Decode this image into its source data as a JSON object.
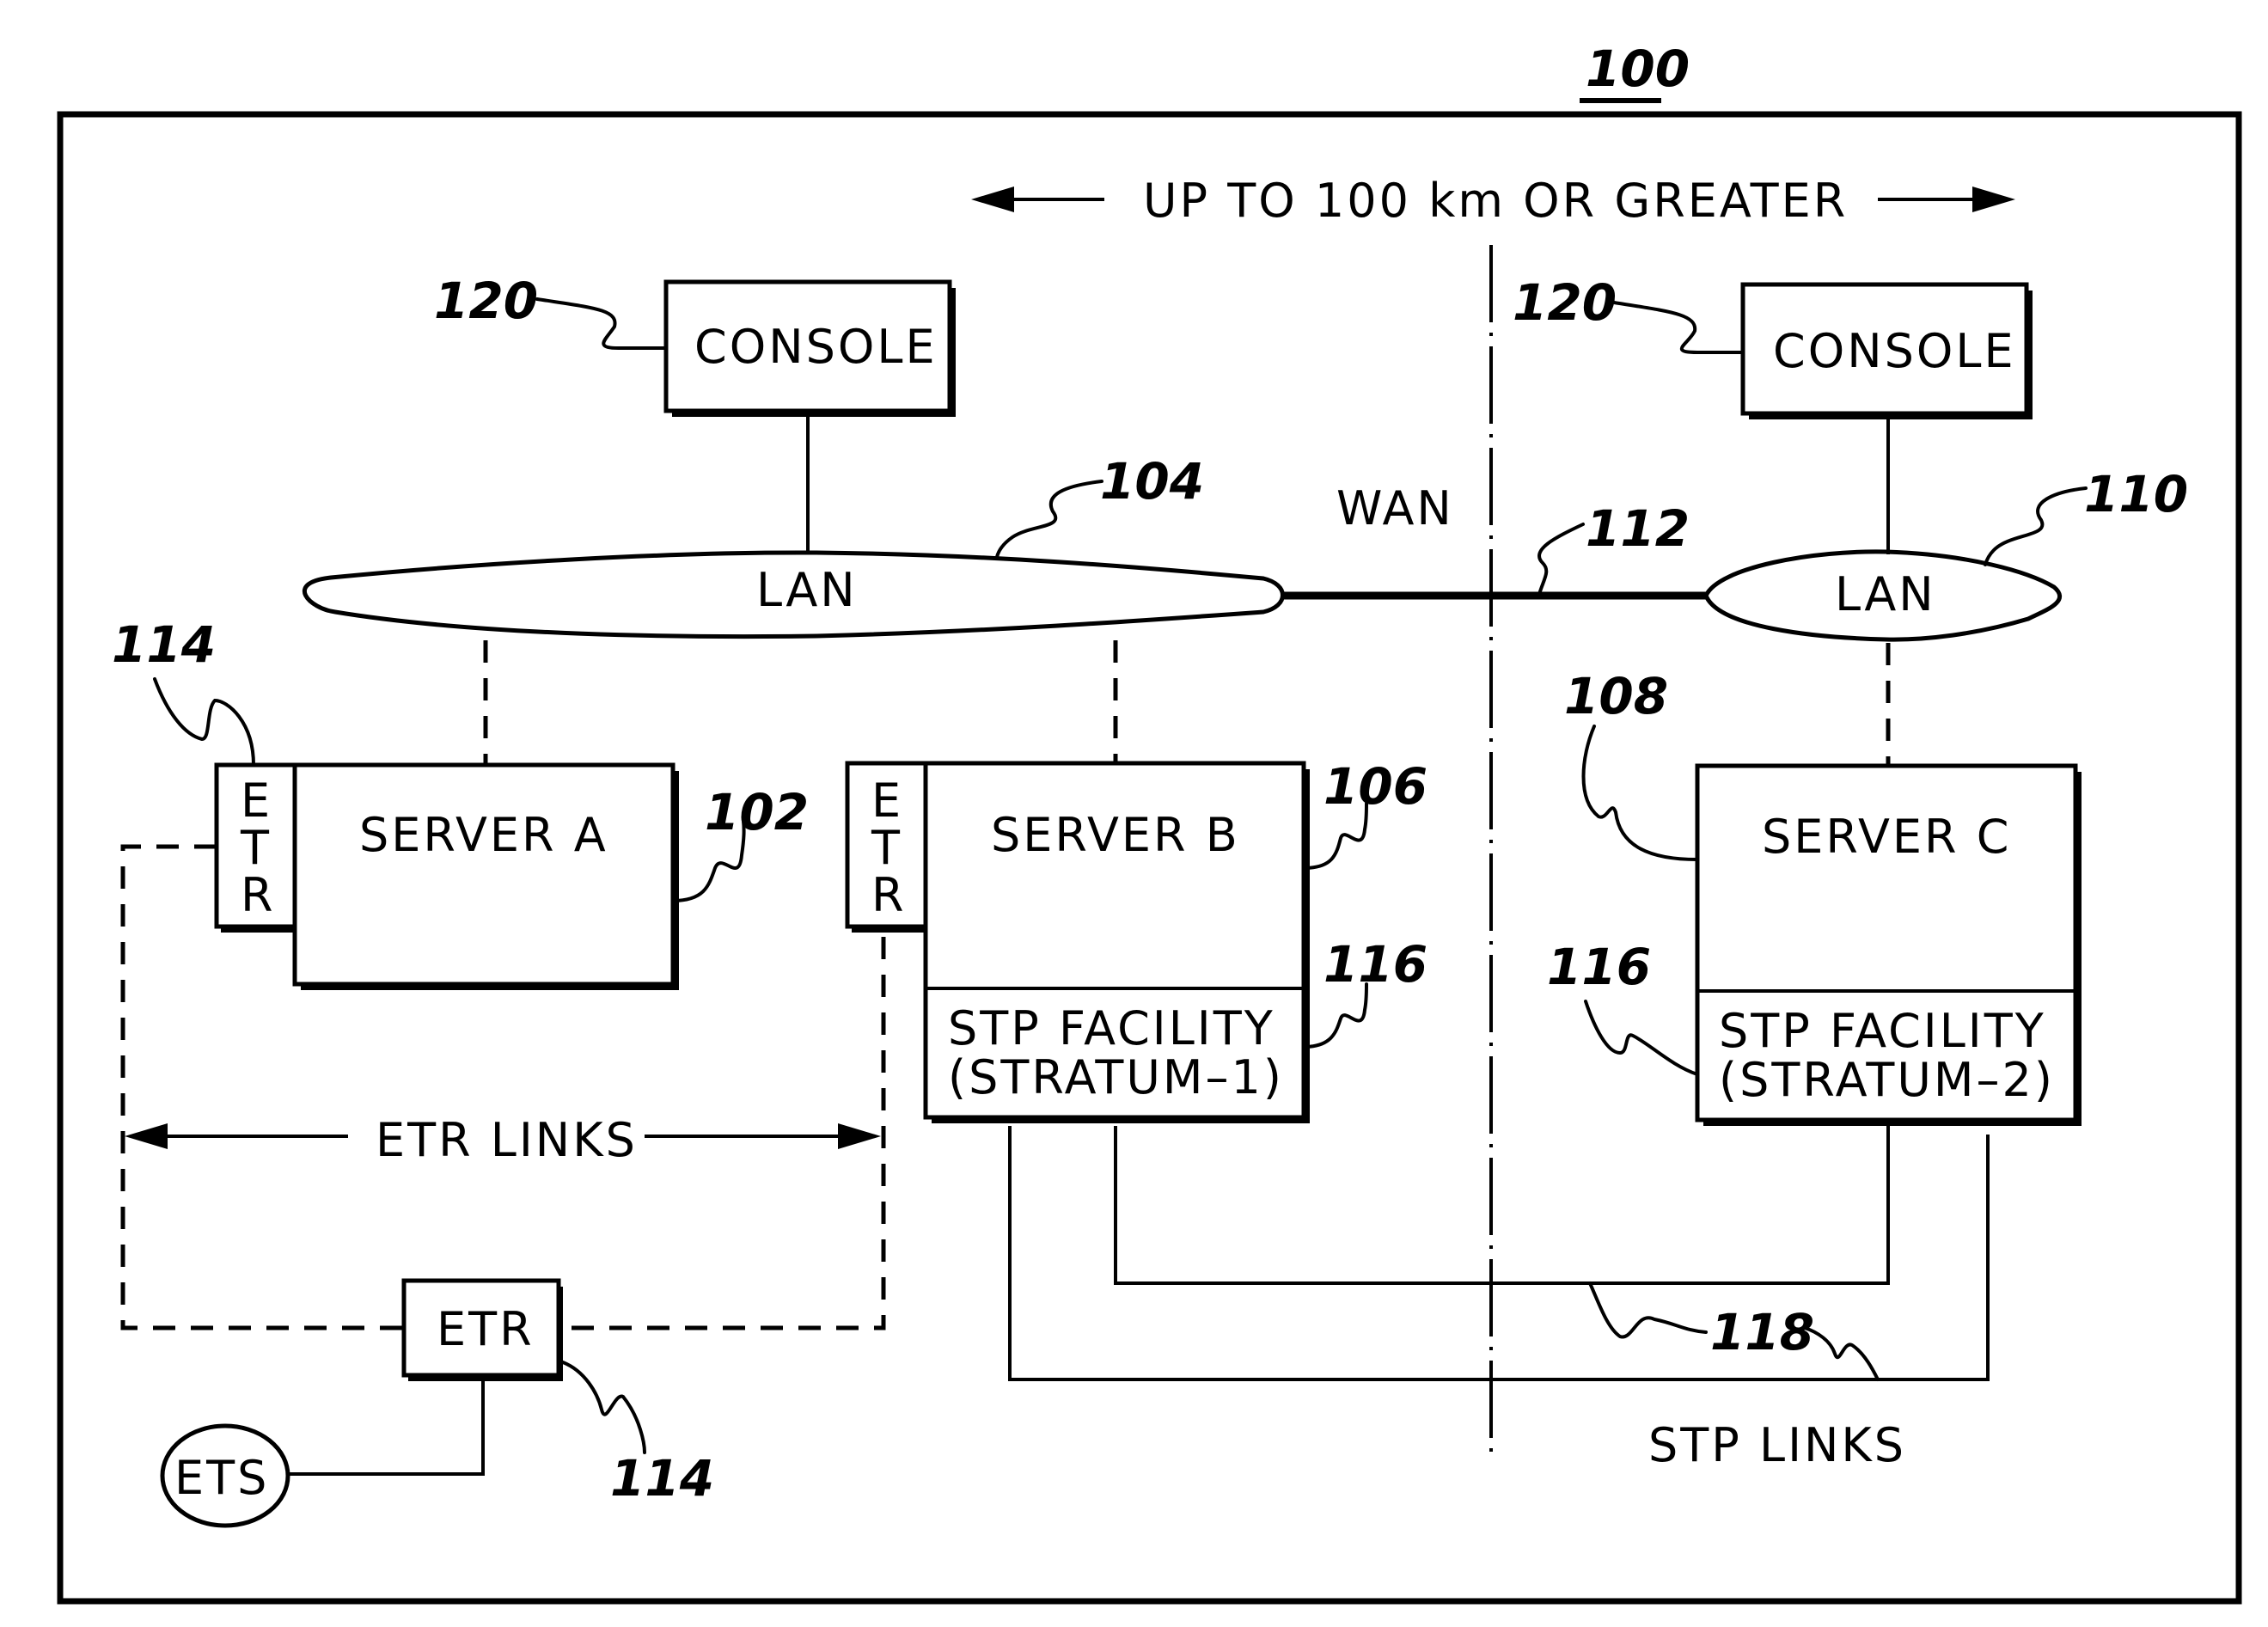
{
  "figure": {
    "number": "100",
    "distance_label": "UP TO 100 km OR GREATER"
  },
  "labels": {
    "wan": "WAN",
    "etr_links": "ETR LINKS",
    "stp_links": "STP LINKS"
  },
  "nodes": {
    "console_left": "CONSOLE",
    "console_right": "CONSOLE",
    "lan_left": "LAN",
    "lan_right": "LAN",
    "server_a": "SERVER A",
    "server_b": "SERVER B",
    "server_c": "SERVER C",
    "stp_b_line1": "STP FACILITY",
    "stp_b_line2": "(STRATUM–1)",
    "stp_c_line1": "STP FACILITY",
    "stp_c_line2": "(STRATUM–2)",
    "etr_vertical": [
      "E",
      "T",
      "R"
    ],
    "etr_box": "ETR",
    "ets": "ETS"
  },
  "refs": {
    "console": "120",
    "lan_left": "104",
    "lan_right": "110",
    "wan_link": "112",
    "etr": "114",
    "server_a": "102",
    "server_b": "106",
    "server_c": "108",
    "stp": "116",
    "stp_links": "118"
  }
}
